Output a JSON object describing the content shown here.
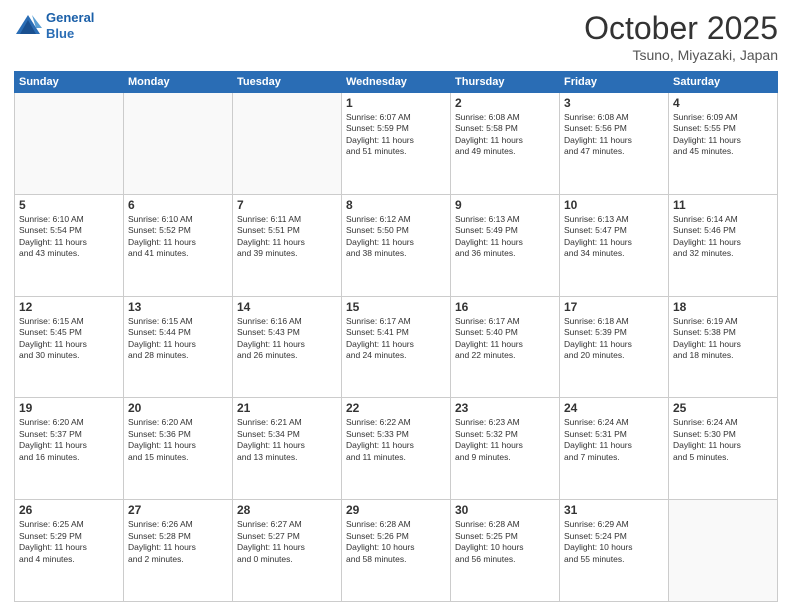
{
  "header": {
    "logo_line1": "General",
    "logo_line2": "Blue",
    "month": "October 2025",
    "location": "Tsuno, Miyazaki, Japan"
  },
  "days_of_week": [
    "Sunday",
    "Monday",
    "Tuesday",
    "Wednesday",
    "Thursday",
    "Friday",
    "Saturday"
  ],
  "weeks": [
    [
      {
        "day": "",
        "info": ""
      },
      {
        "day": "",
        "info": ""
      },
      {
        "day": "",
        "info": ""
      },
      {
        "day": "1",
        "info": "Sunrise: 6:07 AM\nSunset: 5:59 PM\nDaylight: 11 hours\nand 51 minutes."
      },
      {
        "day": "2",
        "info": "Sunrise: 6:08 AM\nSunset: 5:58 PM\nDaylight: 11 hours\nand 49 minutes."
      },
      {
        "day": "3",
        "info": "Sunrise: 6:08 AM\nSunset: 5:56 PM\nDaylight: 11 hours\nand 47 minutes."
      },
      {
        "day": "4",
        "info": "Sunrise: 6:09 AM\nSunset: 5:55 PM\nDaylight: 11 hours\nand 45 minutes."
      }
    ],
    [
      {
        "day": "5",
        "info": "Sunrise: 6:10 AM\nSunset: 5:54 PM\nDaylight: 11 hours\nand 43 minutes."
      },
      {
        "day": "6",
        "info": "Sunrise: 6:10 AM\nSunset: 5:52 PM\nDaylight: 11 hours\nand 41 minutes."
      },
      {
        "day": "7",
        "info": "Sunrise: 6:11 AM\nSunset: 5:51 PM\nDaylight: 11 hours\nand 39 minutes."
      },
      {
        "day": "8",
        "info": "Sunrise: 6:12 AM\nSunset: 5:50 PM\nDaylight: 11 hours\nand 38 minutes."
      },
      {
        "day": "9",
        "info": "Sunrise: 6:13 AM\nSunset: 5:49 PM\nDaylight: 11 hours\nand 36 minutes."
      },
      {
        "day": "10",
        "info": "Sunrise: 6:13 AM\nSunset: 5:47 PM\nDaylight: 11 hours\nand 34 minutes."
      },
      {
        "day": "11",
        "info": "Sunrise: 6:14 AM\nSunset: 5:46 PM\nDaylight: 11 hours\nand 32 minutes."
      }
    ],
    [
      {
        "day": "12",
        "info": "Sunrise: 6:15 AM\nSunset: 5:45 PM\nDaylight: 11 hours\nand 30 minutes."
      },
      {
        "day": "13",
        "info": "Sunrise: 6:15 AM\nSunset: 5:44 PM\nDaylight: 11 hours\nand 28 minutes."
      },
      {
        "day": "14",
        "info": "Sunrise: 6:16 AM\nSunset: 5:43 PM\nDaylight: 11 hours\nand 26 minutes."
      },
      {
        "day": "15",
        "info": "Sunrise: 6:17 AM\nSunset: 5:41 PM\nDaylight: 11 hours\nand 24 minutes."
      },
      {
        "day": "16",
        "info": "Sunrise: 6:17 AM\nSunset: 5:40 PM\nDaylight: 11 hours\nand 22 minutes."
      },
      {
        "day": "17",
        "info": "Sunrise: 6:18 AM\nSunset: 5:39 PM\nDaylight: 11 hours\nand 20 minutes."
      },
      {
        "day": "18",
        "info": "Sunrise: 6:19 AM\nSunset: 5:38 PM\nDaylight: 11 hours\nand 18 minutes."
      }
    ],
    [
      {
        "day": "19",
        "info": "Sunrise: 6:20 AM\nSunset: 5:37 PM\nDaylight: 11 hours\nand 16 minutes."
      },
      {
        "day": "20",
        "info": "Sunrise: 6:20 AM\nSunset: 5:36 PM\nDaylight: 11 hours\nand 15 minutes."
      },
      {
        "day": "21",
        "info": "Sunrise: 6:21 AM\nSunset: 5:34 PM\nDaylight: 11 hours\nand 13 minutes."
      },
      {
        "day": "22",
        "info": "Sunrise: 6:22 AM\nSunset: 5:33 PM\nDaylight: 11 hours\nand 11 minutes."
      },
      {
        "day": "23",
        "info": "Sunrise: 6:23 AM\nSunset: 5:32 PM\nDaylight: 11 hours\nand 9 minutes."
      },
      {
        "day": "24",
        "info": "Sunrise: 6:24 AM\nSunset: 5:31 PM\nDaylight: 11 hours\nand 7 minutes."
      },
      {
        "day": "25",
        "info": "Sunrise: 6:24 AM\nSunset: 5:30 PM\nDaylight: 11 hours\nand 5 minutes."
      }
    ],
    [
      {
        "day": "26",
        "info": "Sunrise: 6:25 AM\nSunset: 5:29 PM\nDaylight: 11 hours\nand 4 minutes."
      },
      {
        "day": "27",
        "info": "Sunrise: 6:26 AM\nSunset: 5:28 PM\nDaylight: 11 hours\nand 2 minutes."
      },
      {
        "day": "28",
        "info": "Sunrise: 6:27 AM\nSunset: 5:27 PM\nDaylight: 11 hours\nand 0 minutes."
      },
      {
        "day": "29",
        "info": "Sunrise: 6:28 AM\nSunset: 5:26 PM\nDaylight: 10 hours\nand 58 minutes."
      },
      {
        "day": "30",
        "info": "Sunrise: 6:28 AM\nSunset: 5:25 PM\nDaylight: 10 hours\nand 56 minutes."
      },
      {
        "day": "31",
        "info": "Sunrise: 6:29 AM\nSunset: 5:24 PM\nDaylight: 10 hours\nand 55 minutes."
      },
      {
        "day": "",
        "info": ""
      }
    ]
  ]
}
